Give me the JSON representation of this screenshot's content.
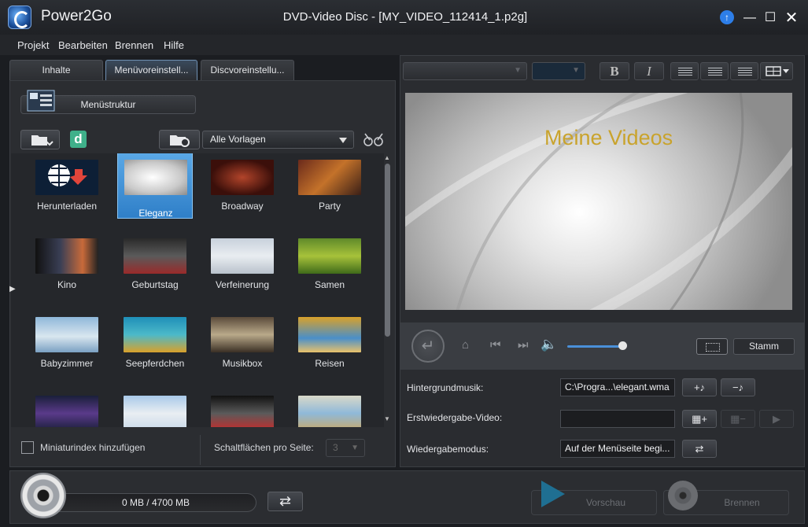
{
  "window": {
    "app_name": "Power2Go",
    "doc_title": "DVD-Video Disc - [MY_VIDEO_112414_1.p2g]"
  },
  "menu": [
    "Projekt",
    "Bearbeiten",
    "Brennen",
    "Hilfe"
  ],
  "tabs": [
    "Inhalte",
    "Menüvoreinstell...",
    "Discvoreinstellu..."
  ],
  "left": {
    "menu_structure_label": "Menüstruktur",
    "template_filter": "Alle Vorlagen",
    "templates": [
      {
        "label": "Herunterladen"
      },
      {
        "label": "Eleganz",
        "selected": true
      },
      {
        "label": "Broadway"
      },
      {
        "label": "Party"
      },
      {
        "label": "Kino"
      },
      {
        "label": "Geburtstag"
      },
      {
        "label": "Verfeinerung"
      },
      {
        "label": "Samen"
      },
      {
        "label": "Babyzimmer"
      },
      {
        "label": "Seepferdchen"
      },
      {
        "label": "Musikbox"
      },
      {
        "label": "Reisen"
      },
      {
        "label": ""
      },
      {
        "label": ""
      },
      {
        "label": ""
      },
      {
        "label": ""
      }
    ],
    "thumbnail_index_label": "Miniaturindex hinzufügen",
    "buttons_per_page_label": "Schaltflächen pro Seite:",
    "buttons_per_page_value": "3"
  },
  "toolbar": {
    "bold": "B",
    "italic": "I"
  },
  "preview": {
    "title": "Meine Videos"
  },
  "player": {
    "root_label": "Stamm"
  },
  "properties": {
    "bg_music_label": "Hintergrundmusik:",
    "bg_music_value": "C:\\Progra...\\elegant.wma",
    "first_play_label": "Erstwiedergabe-Video:",
    "first_play_value": "",
    "playback_mode_label": "Wiedergabemodus:",
    "playback_mode_value": "Auf der Menüseite begi..."
  },
  "bottom": {
    "capacity": "0 MB / 4700 MB",
    "preview_label": "Vorschau",
    "burn_label": "Brennen"
  },
  "colors": {
    "accent": "#2f7fc8",
    "title_gold": "#c9a32c"
  }
}
